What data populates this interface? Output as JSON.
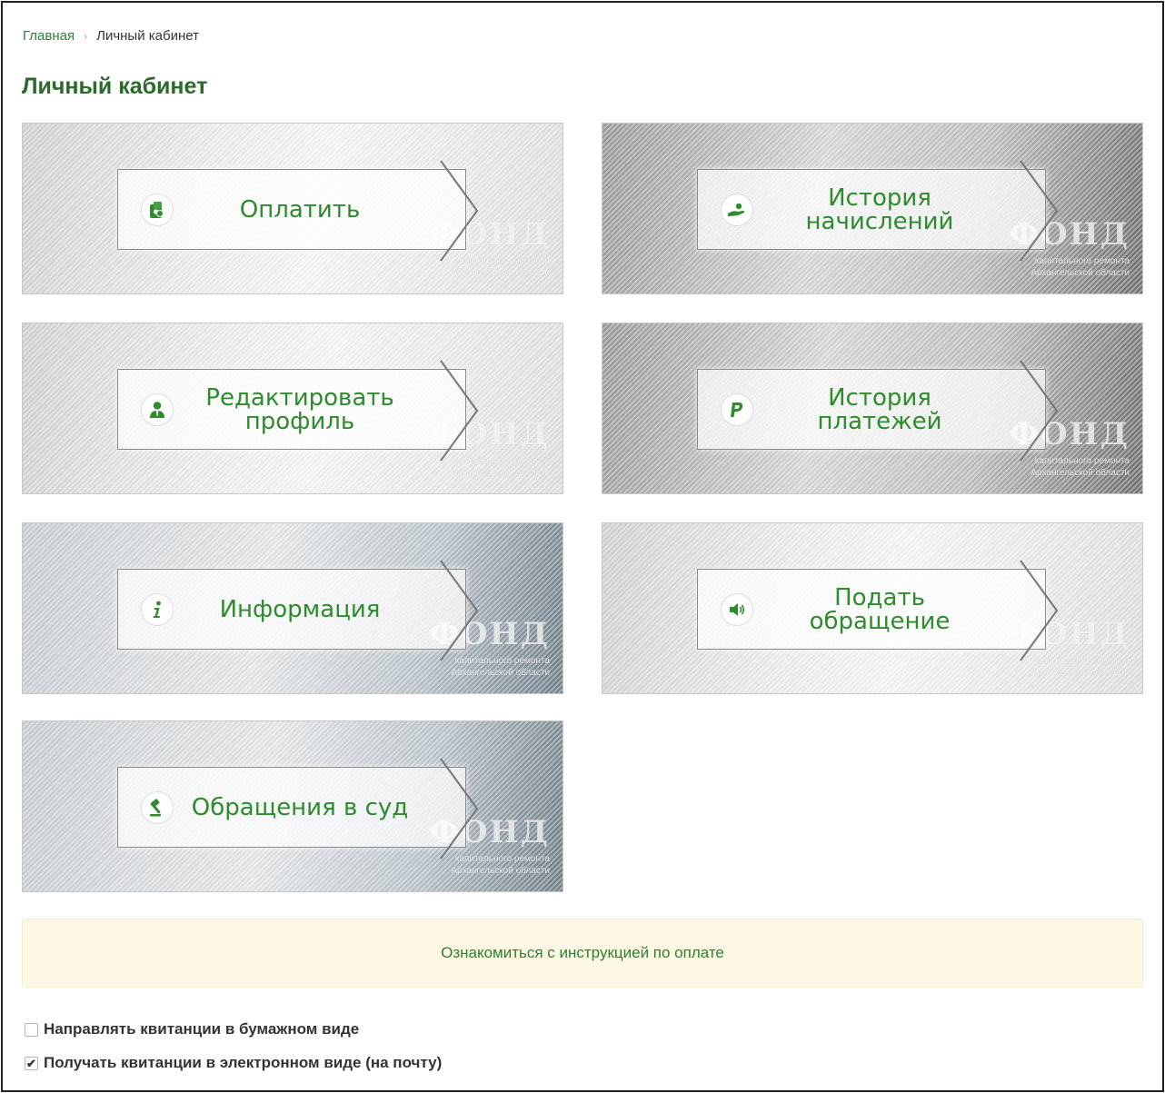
{
  "breadcrumb": {
    "home": "Главная",
    "separator": "›",
    "current": "Личный кабинет"
  },
  "page": {
    "title": "Личный кабинет"
  },
  "watermark": {
    "brand": "ФОНД",
    "sub": "капитального ремонта Архангельской области"
  },
  "tiles": [
    {
      "label": "Оплатить",
      "icon": "money-icon"
    },
    {
      "label": "История начислений",
      "icon": "hand-coin-icon"
    },
    {
      "label": "Редактировать профиль",
      "icon": "user-icon"
    },
    {
      "label": "История платежей",
      "icon": "paypal-icon"
    },
    {
      "label": "Информация",
      "icon": "info-icon"
    },
    {
      "label": "Подать обращение",
      "icon": "speaker-icon"
    },
    {
      "label": "Обращения в суд",
      "icon": "gavel-icon"
    }
  ],
  "notice": {
    "text": "Ознакомиться с инструкцией по оплате"
  },
  "options": [
    {
      "label": "Направлять квитанции в бумажном виде",
      "checked": false
    },
    {
      "label": "Получать квитанции в электронном виде (на почту)",
      "checked": true,
      "mark": "✔"
    }
  ],
  "colors": {
    "accent": "#2e8b2e",
    "title": "#2a6a2a",
    "notice_bg": "#fcf8e3"
  }
}
